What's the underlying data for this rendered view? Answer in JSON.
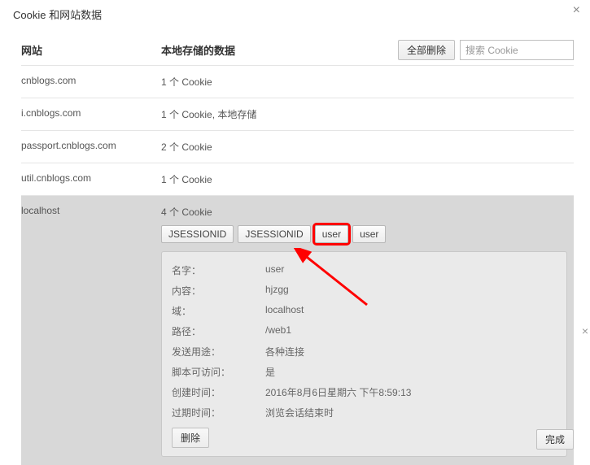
{
  "dialog": {
    "title": "Cookie 和网站数据"
  },
  "headers": {
    "site": "网站",
    "data": "本地存储的数据",
    "delete_all": "全部删除",
    "search_placeholder": "搜索 Cookie"
  },
  "sites": [
    {
      "name": "cnblogs.com",
      "data": "1 个 Cookie"
    },
    {
      "name": "i.cnblogs.com",
      "data": "1 个 Cookie, 本地存储"
    },
    {
      "name": "passport.cnblogs.com",
      "data": "2 个 Cookie"
    },
    {
      "name": "util.cnblogs.com",
      "data": "1 个 Cookie"
    }
  ],
  "expanded": {
    "name": "localhost",
    "data": "4 个 Cookie",
    "chips": [
      "JSESSIONID",
      "JSESSIONID",
      "user",
      "user"
    ],
    "highlighted_index": 2
  },
  "detail": {
    "labels": {
      "name": "名字：",
      "content": "内容：",
      "domain": "域：",
      "path": "路径：",
      "sendfor": "发送用途：",
      "script": "脚本可访问：",
      "created": "创建时间：",
      "expires": "过期时间："
    },
    "values": {
      "name": "user",
      "content": "hjzgg",
      "domain": "localhost",
      "path": "/web1",
      "sendfor": "各种连接",
      "script": "是",
      "created": "2016年8月6日星期六 下午8:59:13",
      "expires": "浏览会话结束时"
    },
    "delete": "删除"
  },
  "footer": {
    "done": "完成"
  }
}
